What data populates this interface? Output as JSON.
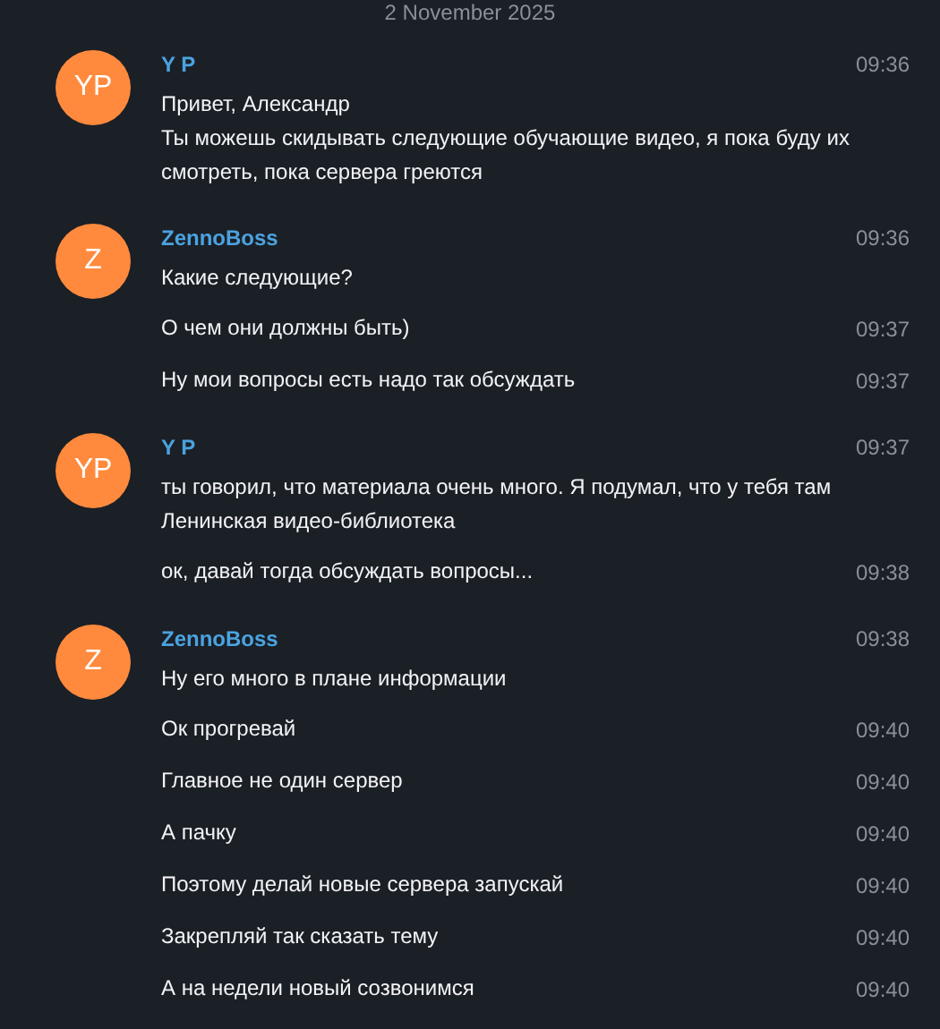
{
  "date_header": "2 November 2025",
  "groups": [
    {
      "initials": "YP",
      "name": "Y P",
      "time": "09:36",
      "messages": [
        {
          "text": "Привет, Александр\nТы можешь скидывать следующие обучающие видео, я пока буду их смотреть, пока сервера греются"
        }
      ]
    },
    {
      "initials": "Z",
      "name": "ZennoBoss",
      "time": "09:36",
      "messages": [
        {
          "text": "Какие следующие?"
        },
        {
          "text": "О чем они должны быть)",
          "time": "09:37"
        },
        {
          "text": "Ну мои вопросы есть надо так обсуждать",
          "time": "09:37"
        }
      ]
    },
    {
      "initials": "YP",
      "name": "Y P",
      "time": "09:37",
      "messages": [
        {
          "text": "ты говорил, что материала очень много. Я подумал, что у тебя там Ленинская видео-библиотека"
        },
        {
          "text": "ок, давай тогда обсуждать вопросы...",
          "time": "09:38"
        }
      ]
    },
    {
      "initials": "Z",
      "name": "ZennoBoss",
      "time": "09:38",
      "messages": [
        {
          "text": "Ну его много в плане информации"
        },
        {
          "text": "Ок прогревай",
          "time": "09:40"
        },
        {
          "text": "Главное не один сервер",
          "time": "09:40"
        },
        {
          "text": "А пачку",
          "time": "09:40"
        },
        {
          "text": "Поэтому делай новые сервера запускай",
          "time": "09:40"
        },
        {
          "text": "Закрепляй так сказать тему",
          "time": "09:40"
        },
        {
          "text": "А на недели новый созвонимся",
          "time": "09:40"
        }
      ]
    }
  ]
}
